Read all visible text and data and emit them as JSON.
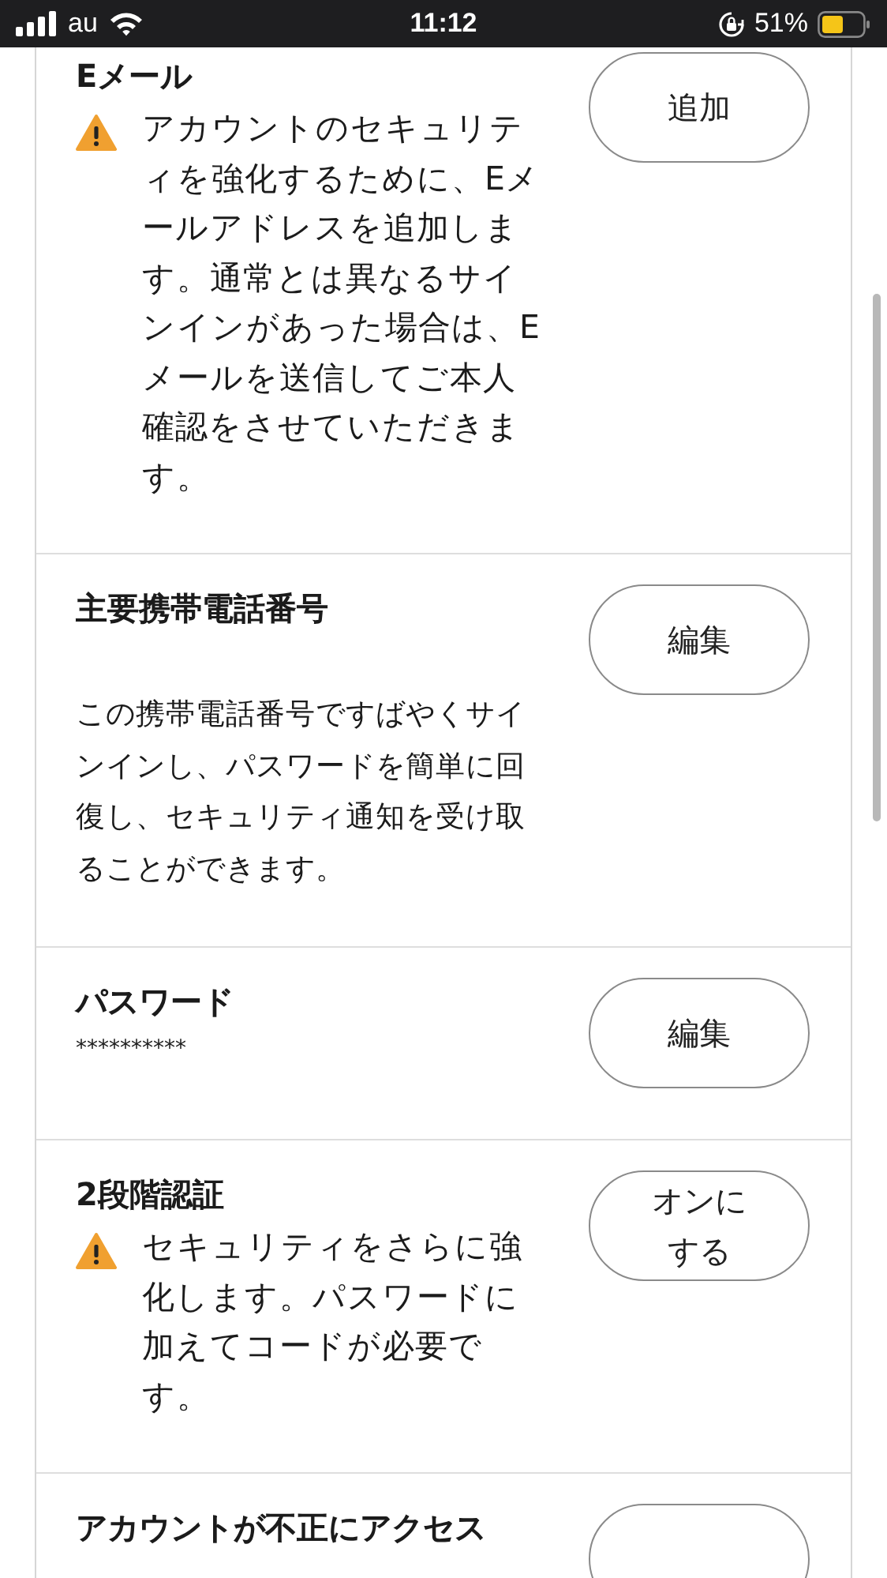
{
  "status_bar": {
    "carrier": "au",
    "time": "11:12",
    "battery": "51%"
  },
  "sections": [
    {
      "title": "Eメール",
      "warning": true,
      "description": "アカウントのセキュリティを強化するために、Eメールアドレスを追加します。通常とは異なるサインインがあった場合は、Eメールを送信してご本人確認をさせていただきます。",
      "button": "追加"
    },
    {
      "title": "主要携帯電話番号",
      "warning": false,
      "description": "この携帯電話番号ですばやくサインインし、パスワードを簡単に回復し、セキュリティ通知を受け取ることができます。",
      "button": "編集"
    },
    {
      "title": "パスワード",
      "warning": false,
      "value": "**********",
      "button": "編集"
    },
    {
      "title": "2段階認証",
      "warning": true,
      "description": "セキュリティをさらに強化します。パスワードに加えてコードが必要です。",
      "button": "オンにする"
    },
    {
      "title": "アカウントが不正にアクセス",
      "warning": false
    }
  ]
}
